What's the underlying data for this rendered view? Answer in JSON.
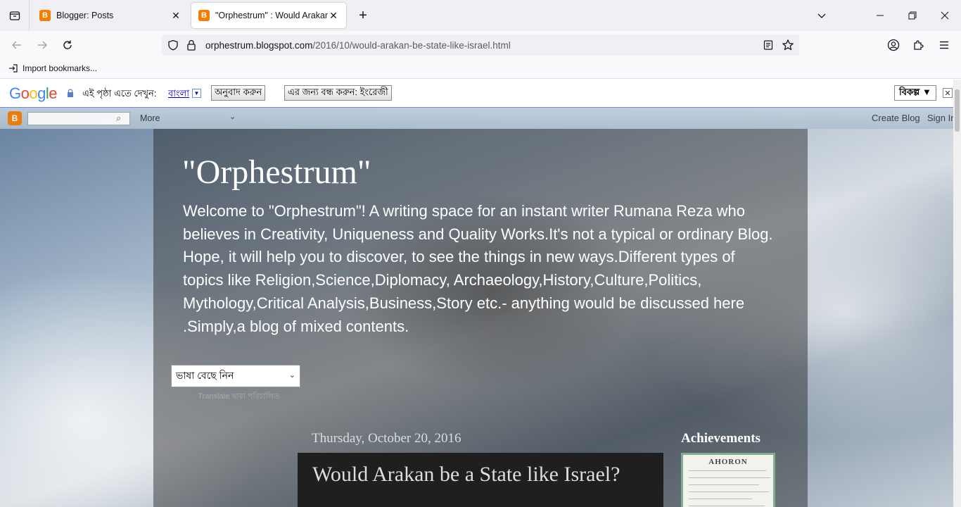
{
  "tabs": [
    {
      "title": "Blogger: Posts",
      "favicon": "blogger-icon"
    },
    {
      "title": "\"Orphestrum\" : Would Arakan be State like Israel",
      "favicon": "blogger-icon"
    }
  ],
  "url": {
    "host": "orphestrum.blogspot.com",
    "path": "/2016/10/would-arakan-be-state-like-israel.html"
  },
  "bookmarks": {
    "import_label": "Import bookmarks..."
  },
  "translate_bar": {
    "logo": [
      "G",
      "o",
      "o",
      "g",
      "l",
      "e"
    ],
    "view_in_label": "এই পৃষ্ঠা এতে দেখুন:",
    "language": "বাংলা",
    "translate_button": "অনুবাদ করুন",
    "turn_off_button": "এর জন্য বন্ধ করুন: ইংরেজী",
    "options_button": "বিকল্প ▼",
    "close": "✕"
  },
  "blogger_nav": {
    "more_label": "More",
    "create_blog": "Create Blog",
    "sign_in": "Sign In"
  },
  "blog": {
    "title": "\"Orphestrum\"",
    "description": "Welcome to \"Orphestrum\"! A writing space for an instant writer Rumana Reza who believes in Creativity, Uniqueness and Quality Works.It's not a typical or ordinary Blog. Hope, it will help you to discover, to see the things in new ways.Different types of topics like Religion,Science,Diplomacy, Archaeology,History,Culture,Politics, Mythology,Critical Analysis,Business,Story etc.- anything would be discussed here .Simply,a blog of mixed contents.",
    "language_select": "ভাষা বেছে নিন",
    "powered_google": "Google",
    "powered_translate": "Translate",
    "powered_suffix": "দ্বারা পরিচালিত",
    "date_header": "Thursday, October 20, 2016",
    "post_title": "Would Arakan be a State like Israel?",
    "sidebar_title": "Achievements",
    "cert_name": "AHORON"
  }
}
